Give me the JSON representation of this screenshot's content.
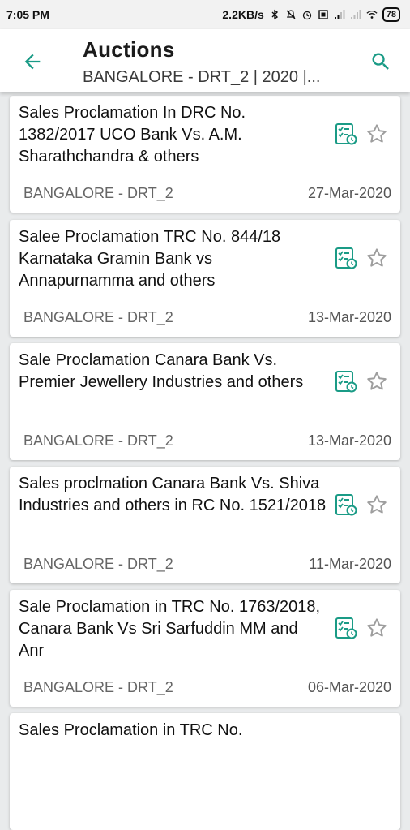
{
  "status_bar": {
    "time": "7:05 PM",
    "network_speed": "2.2KB/s",
    "battery": "78"
  },
  "app_bar": {
    "title": "Auctions",
    "subtitle": "BANGALORE - DRT_2 | 2020 |..."
  },
  "colors": {
    "accent": "#1a9b86",
    "star": "#9e9e9e"
  },
  "auctions": [
    {
      "title": "Sales Proclamation In DRC No. 1382/2017 UCO Bank Vs. A.M. Sharathchandra & others",
      "court": "BANGALORE - DRT_2",
      "date": "27-Mar-2020"
    },
    {
      "title": "Salee Proclamation TRC No. 844/18 Karnataka Gramin Bank vs Annapurnamma and others",
      "court": "BANGALORE - DRT_2",
      "date": "13-Mar-2020"
    },
    {
      "title": "Sale Proclamation  Canara Bank Vs. Premier Jewellery Industries and others",
      "court": "BANGALORE - DRT_2",
      "date": "13-Mar-2020"
    },
    {
      "title": "Sales proclmation  Canara Bank Vs. Shiva Industries and others in RC No. 1521/2018",
      "court": "BANGALORE - DRT_2",
      "date": "11-Mar-2020"
    },
    {
      "title": "Sale Proclamation in TRC No. 1763/2018,  Canara Bank Vs Sri Sarfuddin MM and Anr",
      "court": "BANGALORE - DRT_2",
      "date": "06-Mar-2020"
    },
    {
      "title": "Sales Proclamation in TRC No.",
      "court": "",
      "date": ""
    }
  ]
}
